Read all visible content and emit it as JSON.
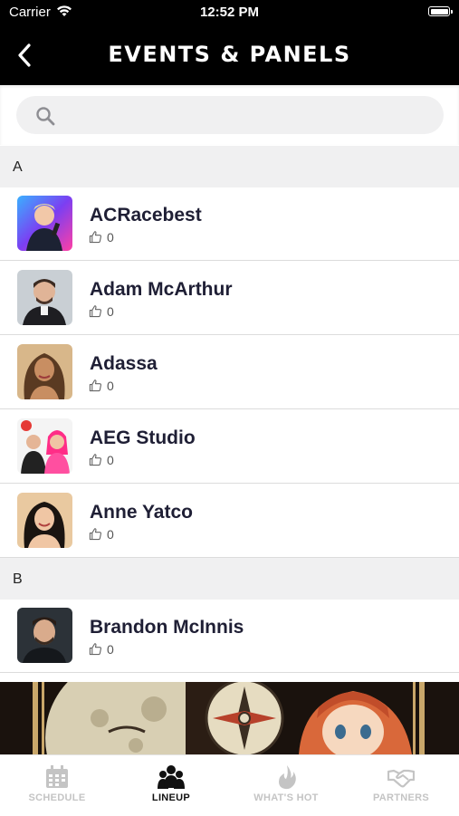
{
  "status_bar": {
    "carrier": "Carrier",
    "time": "12:52 PM"
  },
  "header": {
    "title": "EVENTS & PANELS",
    "back_icon": "chevron-left-icon"
  },
  "search": {
    "placeholder": "",
    "value": ""
  },
  "sections": [
    {
      "letter": "A",
      "items": [
        {
          "name": "ACRacebest",
          "likes": "0"
        },
        {
          "name": "Adam McArthur",
          "likes": "0"
        },
        {
          "name": "Adassa",
          "likes": "0"
        },
        {
          "name": "AEG Studio",
          "likes": "0"
        },
        {
          "name": "Anne Yatco",
          "likes": "0"
        }
      ]
    },
    {
      "letter": "B",
      "items": [
        {
          "name": "Brandon McInnis",
          "likes": "0"
        }
      ]
    }
  ],
  "tabs": [
    {
      "label": "SCHEDULE",
      "icon": "calendar-icon",
      "active": false
    },
    {
      "label": "LINEUP",
      "icon": "people-icon",
      "active": true
    },
    {
      "label": "WHAT'S HOT",
      "icon": "flame-icon",
      "active": false
    },
    {
      "label": "PARTNERS",
      "icon": "handshake-icon",
      "active": false
    }
  ],
  "colors": {
    "nav_bg": "#000000",
    "section_bg": "#f0f0f1",
    "name_text": "#1f1f35",
    "tab_inactive": "#c4c4c4",
    "tab_active": "#111111"
  }
}
